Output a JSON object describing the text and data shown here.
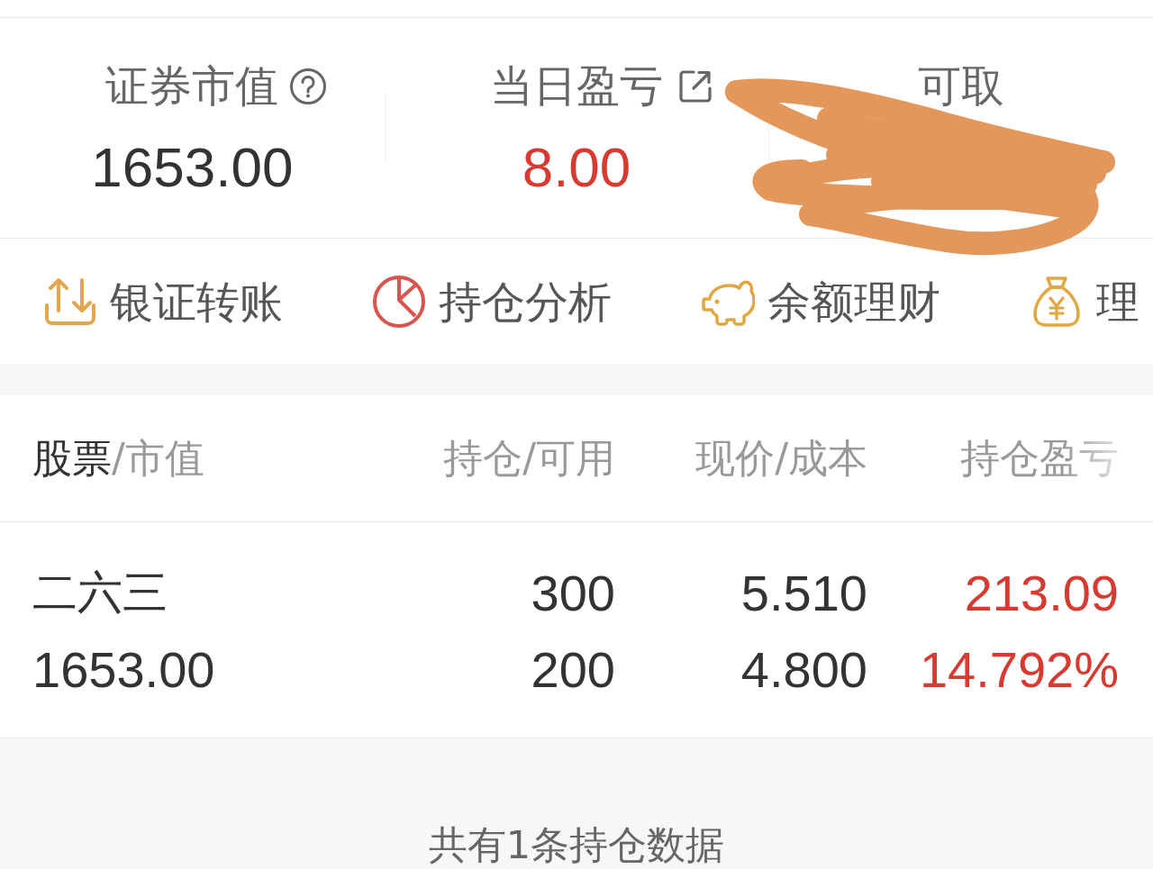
{
  "summary": {
    "stats": [
      {
        "label": "证券市值",
        "value": "1653.00"
      },
      {
        "label": "当日盈亏",
        "value": "8.00",
        "gain": true
      },
      {
        "label": "可取",
        "redacted": true
      }
    ]
  },
  "quick_actions": [
    {
      "label": "银证转账"
    },
    {
      "label": "持仓分析"
    },
    {
      "label": "余额理财"
    },
    {
      "label": "理"
    }
  ],
  "table": {
    "columns": [
      {
        "label": "股票",
        "suffix": "/市值",
        "selected": true
      },
      {
        "label": "持仓/可用",
        "selected": false
      },
      {
        "label": "现价/成本",
        "selected": false
      },
      {
        "label": "持仓盈亏",
        "selected": false
      }
    ],
    "rows": [
      {
        "name": "二六三",
        "market_value": "1653.00",
        "holding": "300",
        "available": "200",
        "price": "5.510",
        "cost": "4.800",
        "pnl": "213.09",
        "pnl_percent": "14.792%",
        "gain": true
      }
    ]
  },
  "footer": {
    "text": "共有1条持仓数据"
  }
}
